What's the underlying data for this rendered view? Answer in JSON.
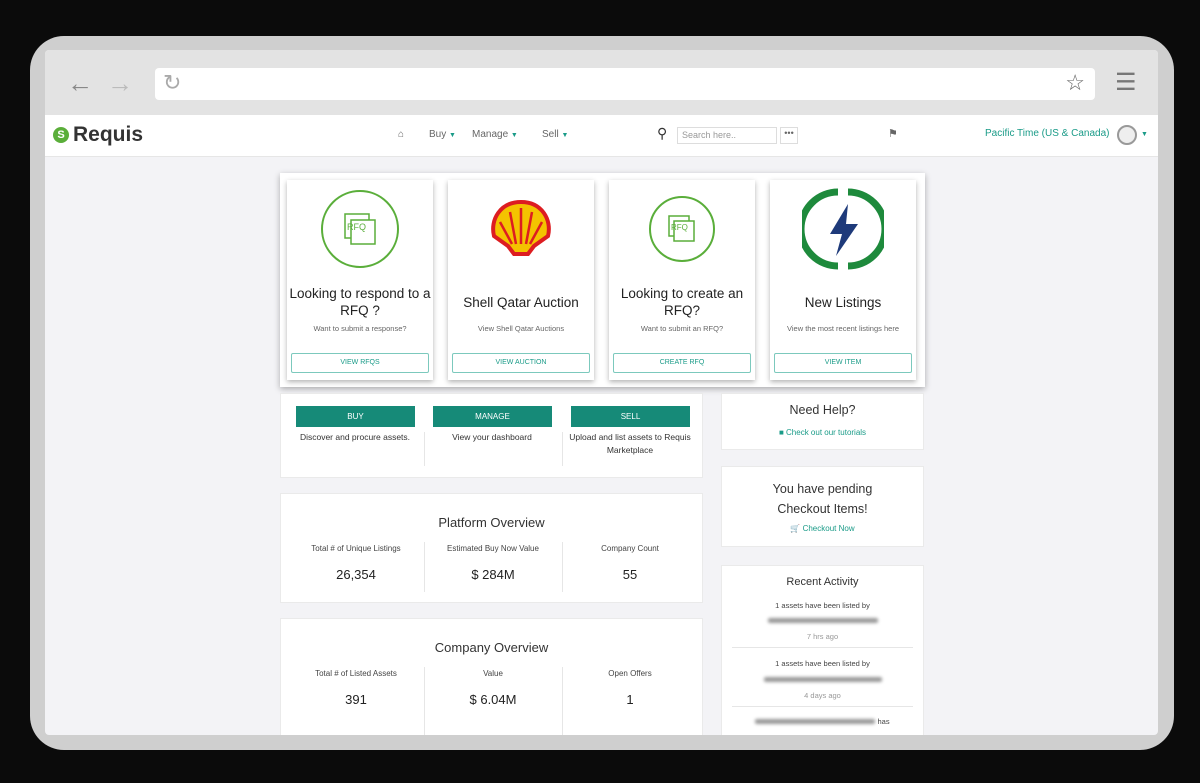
{
  "browser": {
    "back_icon": "arrow-left-icon",
    "forward_icon": "arrow-right-icon",
    "reload_icon": "reload-icon",
    "star_icon": "star-icon",
    "menu_icon": "hamburger-icon"
  },
  "header": {
    "logo": "Requis",
    "home_icon": "home-icon",
    "menu": [
      "Buy",
      "Manage",
      "Sell"
    ],
    "search_placeholder": "Search here..",
    "more": "•••",
    "timezone": "Pacific Time (US & Canada)"
  },
  "cards": [
    {
      "title": "Looking to respond to a RFQ ?",
      "subtitle": "Want to submit a response?",
      "button": "VIEW RFQS",
      "icon": "rfq-icon"
    },
    {
      "title": "Shell Qatar Auction",
      "subtitle": "View Shell Qatar Auctions",
      "button": "VIEW AUCTION",
      "icon": "shell-logo"
    },
    {
      "title": "Looking to create an RFQ?",
      "subtitle": "Want to submit an RFQ?",
      "button": "CREATE RFQ",
      "icon": "rfq-icon"
    },
    {
      "title": "New Listings",
      "subtitle": "View the most recent listings here",
      "button": "VIEW ITEM",
      "icon": "lightning-icon"
    }
  ],
  "actions": [
    {
      "button": "BUY",
      "desc": "Discover and procure assets."
    },
    {
      "button": "MANAGE",
      "desc": "View your dashboard"
    },
    {
      "button": "SELL",
      "desc": "Upload and list assets to Requis Marketplace"
    }
  ],
  "platform": {
    "title": "Platform Overview",
    "stats": [
      {
        "label": "Total # of Unique Listings",
        "value": "26,354"
      },
      {
        "label": "Estimated Buy Now Value",
        "value": "$ 284M"
      },
      {
        "label": "Company Count",
        "value": "55"
      }
    ]
  },
  "company": {
    "title": "Company Overview",
    "stats": [
      {
        "label": "Total # of Listed Assets",
        "value": "391"
      },
      {
        "label": "Value",
        "value": "$ 6.04M"
      },
      {
        "label": "Open Offers",
        "value": "1"
      }
    ]
  },
  "help": {
    "title": "Need Help?",
    "link": "Check out our tutorials"
  },
  "checkout": {
    "title": "You have pending Checkout Items!",
    "link": "Checkout Now"
  },
  "activity": {
    "title": "Recent Activity",
    "items": [
      {
        "text": "1 assets have been listed by",
        "time": "7 hrs ago"
      },
      {
        "text": "1 assets have been listed by",
        "time": "4 days ago"
      },
      {
        "text": "has"
      }
    ]
  },
  "colors": {
    "accent": "#1a9b88",
    "button": "#168a78",
    "logo_green": "#5aae3a"
  }
}
